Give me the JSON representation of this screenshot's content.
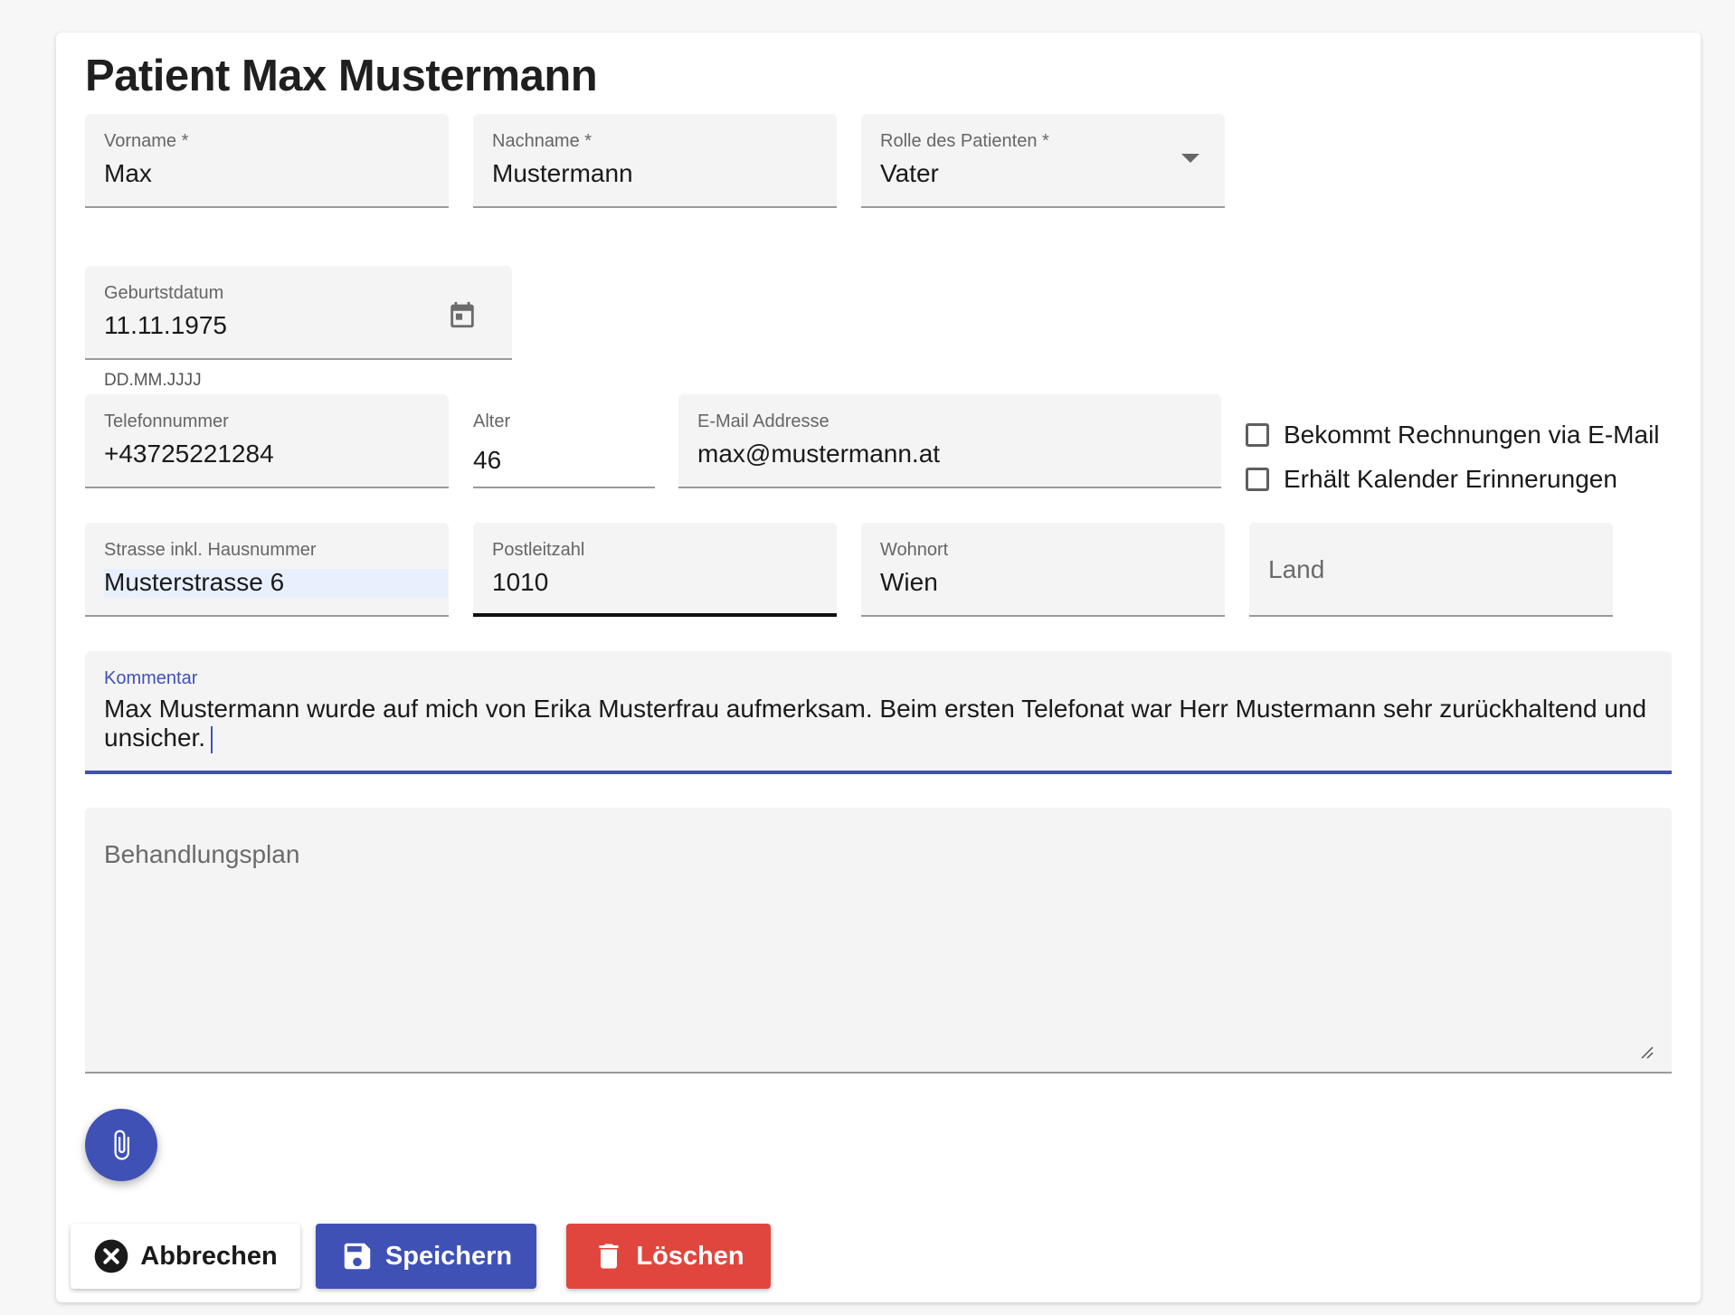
{
  "page": {
    "title": "Patient Max Mustermann"
  },
  "fields": {
    "vorname": {
      "label": "Vorname *",
      "value": "Max"
    },
    "nachname": {
      "label": "Nachname *",
      "value": "Mustermann"
    },
    "rolle": {
      "label": "Rolle des Patienten *",
      "value": "Vater"
    },
    "geburtsdatum": {
      "label": "Geburtstdatum",
      "value": "11.11.1975",
      "helper": "DD.MM.JJJJ"
    },
    "telefon": {
      "label": "Telefonnummer",
      "value": "+43725221284"
    },
    "alter": {
      "label": "Alter",
      "value": "46"
    },
    "email": {
      "label": "E-Mail Addresse",
      "value": "max@mustermann.at"
    },
    "strasse": {
      "label": "Strasse inkl. Hausnummer",
      "value": "Musterstrasse 6"
    },
    "plz": {
      "label": "Postleitzahl",
      "value": "1010"
    },
    "wohnort": {
      "label": "Wohnort",
      "value": "Wien"
    },
    "land": {
      "label": "Land",
      "value": ""
    },
    "kommentar": {
      "label": "Kommentar",
      "value": "Max Mustermann wurde auf mich von Erika Musterfrau aufmerksam. Beim ersten Telefonat war Herr Mustermann sehr zurückhaltend und unsicher."
    },
    "behandlungsplan": {
      "label": "Behandlungsplan",
      "value": ""
    }
  },
  "checkboxes": {
    "rechnungen": {
      "label": "Bekommt Rechnungen via E-Mail",
      "checked": false
    },
    "kalender": {
      "label": "Erhält Kalender Erinnerungen",
      "checked": false
    }
  },
  "actions": {
    "cancel_label": "Abbrechen",
    "save_label": "Speichern",
    "delete_label": "Löschen"
  },
  "icons": {
    "dropdown": "chevron-down-icon",
    "calendar": "calendar-icon",
    "attachment": "paperclip-icon",
    "cancel": "close-circle-icon",
    "save": "floppy-disk-icon",
    "delete": "trash-icon"
  },
  "colors": {
    "primary": "#3f51b5",
    "danger": "#e1463e",
    "field_background": "#f4f4f4"
  }
}
